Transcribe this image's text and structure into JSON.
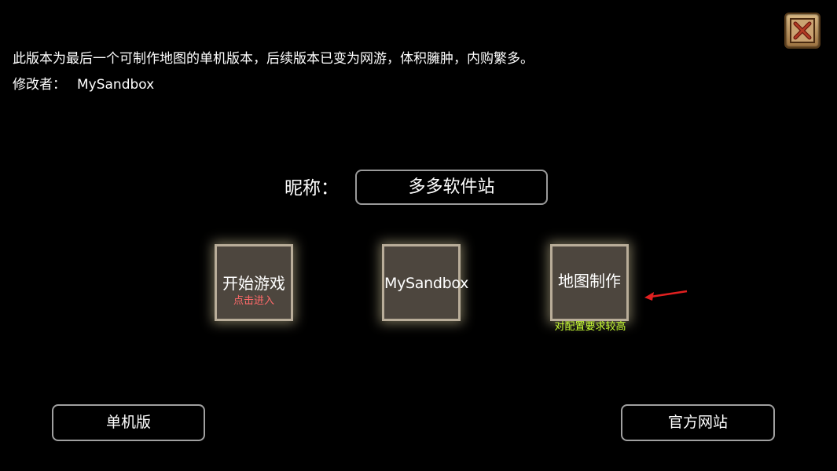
{
  "notice_text": "此版本为最后一个可制作地图的单机版本，后续版本已变为网游，体积臃肿，内购繁多。",
  "author": {
    "label": "修改者：",
    "value": "MySandbox"
  },
  "nickname": {
    "label": "昵称：",
    "value": "多多软件站"
  },
  "tiles": [
    {
      "label": "开始游戏",
      "sub": "点击进入"
    },
    {
      "label": "MySandbox"
    },
    {
      "label": "地图制作",
      "note": "对配置要求较高"
    }
  ],
  "buttons": {
    "standalone": "单机版",
    "official_site": "官方网站"
  },
  "icons": {
    "close": "close-icon",
    "arrow": "arrow-icon"
  },
  "colors": {
    "tile_bg": "#4d463e",
    "sub_text": "#ff6a6a",
    "note_text": "#c8ff33",
    "arrow": "#e02020"
  }
}
